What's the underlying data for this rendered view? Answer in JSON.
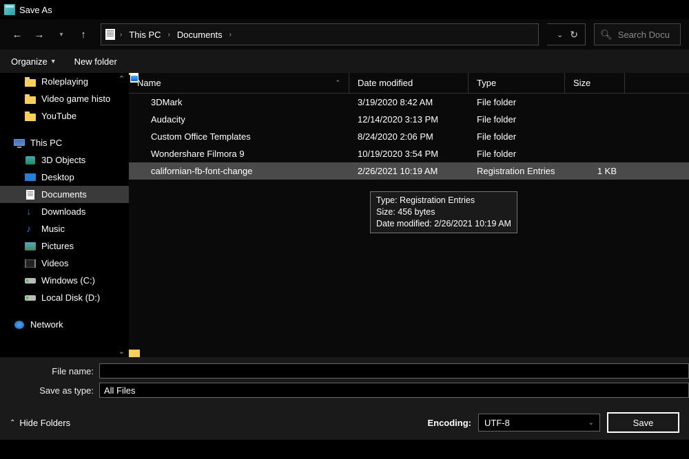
{
  "title": "Save As",
  "breadcrumb": {
    "root": "This PC",
    "current": "Documents"
  },
  "search": {
    "placeholder": "Search Docu"
  },
  "toolbar": {
    "organize": "Organize",
    "newfolder": "New folder"
  },
  "sidebar": {
    "qa": [
      {
        "label": "Roleplaying",
        "icon": "folder"
      },
      {
        "label": "Video game histo",
        "icon": "folder"
      },
      {
        "label": "YouTube",
        "icon": "folder"
      }
    ],
    "thispc": "This PC",
    "pcitems": [
      {
        "label": "3D Objects",
        "icon": "obj"
      },
      {
        "label": "Desktop",
        "icon": "desk"
      },
      {
        "label": "Documents",
        "icon": "doc",
        "selected": true
      },
      {
        "label": "Downloads",
        "icon": "dl"
      },
      {
        "label": "Music",
        "icon": "music"
      },
      {
        "label": "Pictures",
        "icon": "pic"
      },
      {
        "label": "Videos",
        "icon": "vid"
      },
      {
        "label": "Windows (C:)",
        "icon": "drive"
      },
      {
        "label": "Local Disk (D:)",
        "icon": "drive"
      }
    ],
    "network": "Network"
  },
  "columns": {
    "name": "Name",
    "date": "Date modified",
    "type": "Type",
    "size": "Size"
  },
  "files": [
    {
      "name": "3DMark",
      "date": "3/19/2020 8:42 AM",
      "type": "File folder",
      "size": "",
      "icon": "folder"
    },
    {
      "name": "Audacity",
      "date": "12/14/2020 3:13 PM",
      "type": "File folder",
      "size": "",
      "icon": "folder"
    },
    {
      "name": "Custom Office Templates",
      "date": "8/24/2020 2:06 PM",
      "type": "File folder",
      "size": "",
      "icon": "folder"
    },
    {
      "name": "Wondershare Filmora 9",
      "date": "10/19/2020 3:54 PM",
      "type": "File folder",
      "size": "",
      "icon": "folder"
    },
    {
      "name": "californian-fb-font-change",
      "date": "2/26/2021 10:19 AM",
      "type": "Registration Entries",
      "size": "1 KB",
      "icon": "reg",
      "selected": true
    }
  ],
  "tooltip": {
    "l1": "Type: Registration Entries",
    "l2": "Size: 456 bytes",
    "l3": "Date modified: 2/26/2021 10:19 AM"
  },
  "form": {
    "filename_label": "File name:",
    "savetype_label": "Save as type:",
    "savetype_value": "All Files"
  },
  "footer": {
    "hidefolders": "Hide Folders",
    "encoding_label": "Encoding:",
    "encoding_value": "UTF-8",
    "save": "Save"
  }
}
